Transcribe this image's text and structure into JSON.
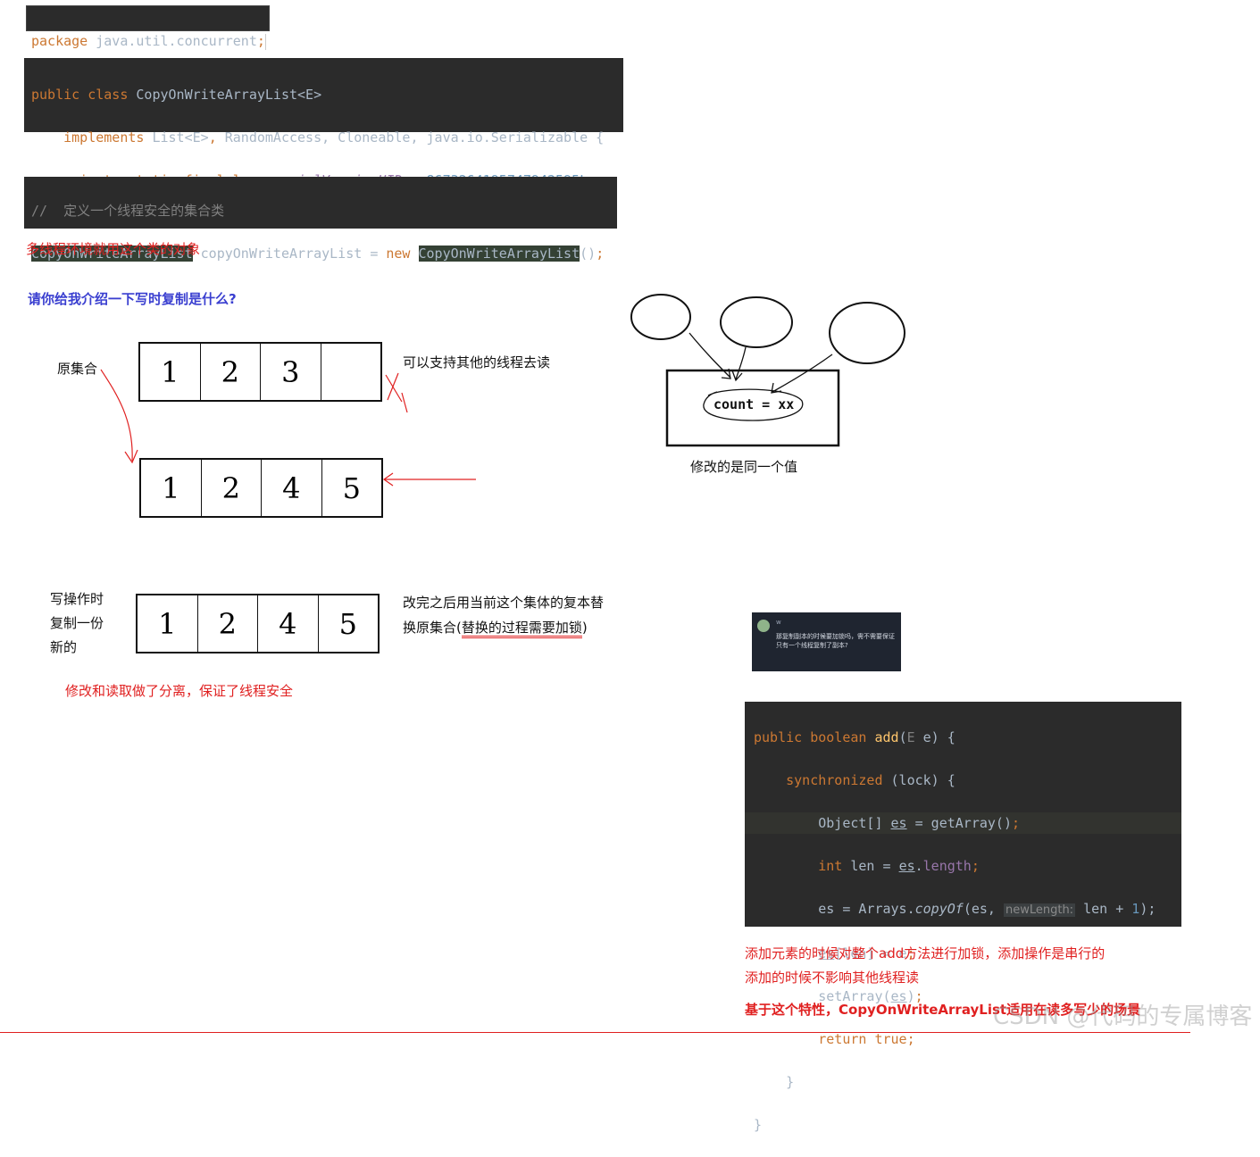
{
  "code_package": {
    "keyword": "package",
    "name": "java.util.concurrent",
    "end": ";"
  },
  "code_class": {
    "l1_kw": "public class",
    "l1_name": "CopyOnWriteArrayList",
    "l1_generic": "<E>",
    "l2_kw": "implements",
    "l2_list": "List",
    "l2_generic": "<E>",
    "l2_rest": "RandomAccess, Cloneable, java.io.Serializable {",
    "l3_kw": "private static final long",
    "l3_field": "serialVersionUID",
    "l3_eq": "=",
    "l3_num": "8673264195747942595L",
    "l3_end": ";"
  },
  "code_decl": {
    "comment": "//  定义一个线程安全的集合类",
    "type": "CopyOnWriteArrayList",
    "var": "copyOnWriteArrayList",
    "eq": "=",
    "new_kw": "new",
    "ctor": "CopyOnWriteArrayList",
    "parens": "()",
    "end": ";"
  },
  "notes": {
    "multi_thread": "多线程环境就用这个类的对象",
    "question": "请你给我介绍一下写时复制是什么?",
    "original_set": "原集合",
    "support_read": "可以支持其他的线程去读",
    "write_copy": [
      "写操作时",
      "复制一份",
      "新的"
    ],
    "replace_1": "改完之后用当前这个集体的复本替",
    "replace_2a": "换原集合(",
    "replace_2b": "替换的过程需要加锁",
    "replace_2c": ")",
    "separation": "修改和读取做了分离，保证了线程安全",
    "same_value": "修改的是同一个值",
    "count_label": "count = xx",
    "add_lock": "添加元素的时候对整个add方法进行加锁，添加操作是串行的",
    "no_affect": "添加的时候不影响其他线程读",
    "conclusion": "基于这个特性，CopyOnWriteArrayList适用在读多写少的场景"
  },
  "arrays": {
    "row1": [
      "1",
      "2",
      "3",
      ""
    ],
    "row2": [
      "1",
      "2",
      "4",
      "5"
    ],
    "row3": [
      "1",
      "2",
      "4",
      "5"
    ]
  },
  "comment_popup": {
    "user": "w",
    "text": "那复制副本的时候要加锁吗，需不需要保证只有一个线程复制了副本?"
  },
  "code_add": {
    "l1_kw": "public boolean",
    "l1_fn": "add",
    "l1_param_type": "E",
    "l1_param": "e) {",
    "l2_kw": "synchronized",
    "l2_rest": "(lock) {",
    "l3_type": "Object[]",
    "l3_var": "es",
    "l3_eq": "= getArray()",
    "l3_end": ";",
    "l4_kw": "int",
    "l4_rest": "len =",
    "l4_var": "es",
    "l4_field": "length",
    "l4_end": ";",
    "l5_a": "es = Arrays.",
    "l5_fn": "copyOf",
    "l5_b": "(es,",
    "l5_hint": "newLength:",
    "l5_c": "len +",
    "l5_num": "1",
    "l5_d": ");",
    "l6_var": "es",
    "l6_rest": "[len] = e",
    "l6_end": ";",
    "l7_a": "setArray(",
    "l7_var": "es",
    "l7_b": ")",
    "l7_end": ";",
    "l8_kw": "return true",
    "l8_end": ";",
    "l9": "}",
    "l10": "}"
  },
  "watermark": "CSDN @代码的专属博客",
  "colors": {
    "code_bg": "#2b2b2b",
    "keyword": "#cc7832",
    "number": "#6897bb",
    "field": "#9876aa",
    "red_note": "#e02020",
    "blue_note": "#3a3fd0"
  }
}
